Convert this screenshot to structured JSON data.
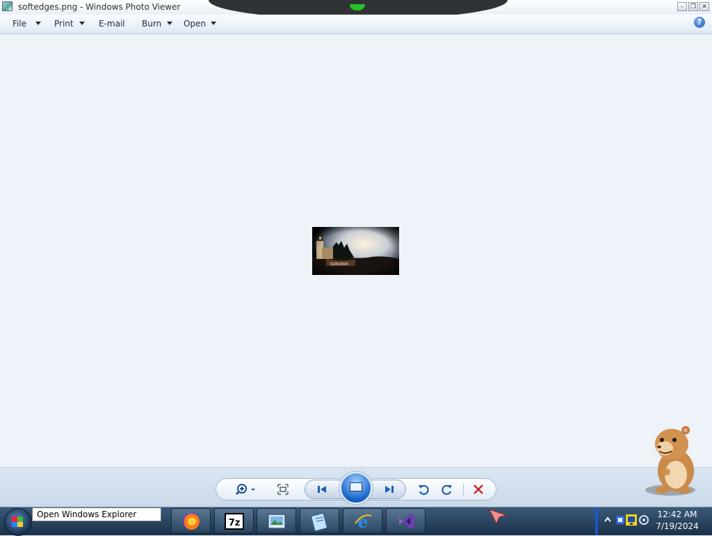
{
  "window": {
    "title": "softedges.png - Windows Photo Viewer",
    "controls": {
      "minimize": "–",
      "restore": "❐",
      "close": "✕"
    }
  },
  "menu": {
    "items": [
      {
        "label": "File",
        "has_dropdown": true
      },
      {
        "label": "Print",
        "has_dropdown": true
      },
      {
        "label": "E-mail",
        "has_dropdown": false
      },
      {
        "label": "Burn",
        "has_dropdown": true
      },
      {
        "label": "Open",
        "has_dropdown": true
      }
    ],
    "help_label": "?"
  },
  "photo": {
    "file": "softedges.png",
    "date_stamp": "5/26/2004"
  },
  "controls": {
    "zoom_icon": "zoom-icon",
    "actual_size_icon": "actual-size-icon",
    "previous_icon": "previous-icon",
    "slideshow_icon": "slideshow-icon",
    "next_icon": "next-icon",
    "rotate_left_icon": "rotate-counterclockwise-icon",
    "rotate_right_icon": "rotate-clockwise-icon",
    "delete_icon": "delete-icon",
    "accent": "#1763c7",
    "delete_color": "#d0242a"
  },
  "taskbar": {
    "tooltip": "Open Windows Explorer",
    "apps": [
      {
        "name": "Firefox",
        "icon": "firefox-icon"
      },
      {
        "name": "7-Zip",
        "icon": "7zip-icon",
        "label": "7z"
      },
      {
        "name": "Windows Photo Viewer",
        "icon": "photo-viewer-icon"
      },
      {
        "name": "Notepad",
        "icon": "notepad-icon"
      },
      {
        "name": "Internet Explorer",
        "icon": "internet-explorer-icon"
      },
      {
        "name": "Visual Studio",
        "icon": "visual-studio-icon"
      }
    ],
    "clock": {
      "time": "12:42 AM",
      "date": "7/19/2024"
    }
  }
}
